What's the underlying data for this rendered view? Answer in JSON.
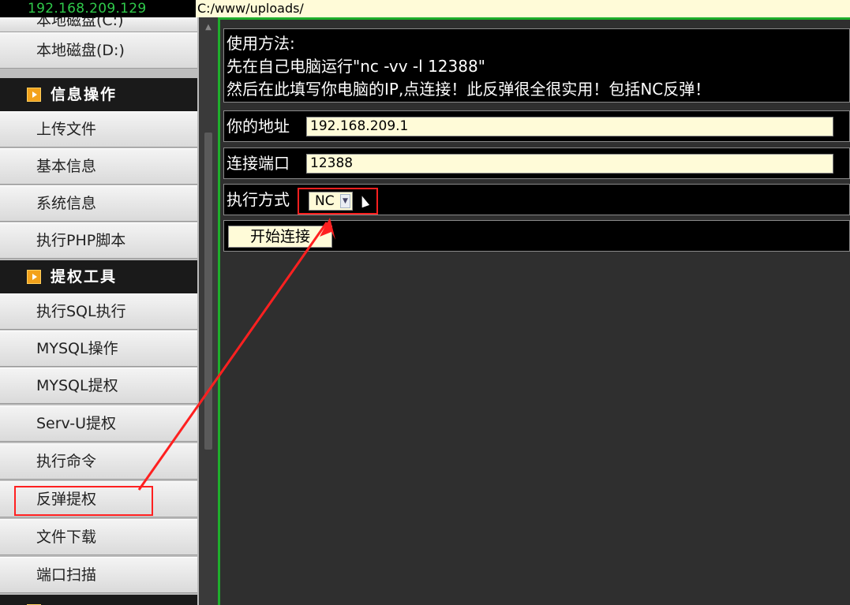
{
  "top_bar": {
    "ip": "192.168.209.129",
    "path": "C:/www/uploads/"
  },
  "sidebar": {
    "partial_item": "本地磁盘(C:)",
    "items": [
      {
        "label": "本地磁盘(D:)"
      },
      {
        "header": "信息操作"
      },
      {
        "label": "上传文件"
      },
      {
        "label": "基本信息"
      },
      {
        "label": "系统信息"
      },
      {
        "label": "执行PHP脚本"
      },
      {
        "header": "提权工具"
      },
      {
        "label": "执行SQL执行"
      },
      {
        "label": "MYSQL操作"
      },
      {
        "label": "MYSQL提权"
      },
      {
        "label": "Serv-U提权"
      },
      {
        "label": "执行命令"
      },
      {
        "label": "反弹提权"
      },
      {
        "label": "文件下载"
      },
      {
        "label": "端口扫描"
      }
    ]
  },
  "main": {
    "usage_lines": [
      "使用方法:",
      "先在自己电脑运行\"nc -vv -l 12388\"",
      "然后在此填写你电脑的IP,点连接！此反弹很全很实用！包括NC反弹！"
    ],
    "address": {
      "label": "你的地址",
      "value": "192.168.209.1"
    },
    "port": {
      "label": "连接端口",
      "value": "12388"
    },
    "method": {
      "label": "执行方式",
      "selected": "NC"
    },
    "connect_label": "开始连接"
  },
  "annotation_color": "#ff2020",
  "accent_green": "#1fae2c"
}
